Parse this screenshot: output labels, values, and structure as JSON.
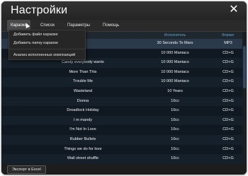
{
  "window": {
    "title": "Настройки",
    "close_glyph": "✕"
  },
  "tabs": [
    {
      "label": "Караоке"
    },
    {
      "label": "Список"
    },
    {
      "label": "Параметры"
    },
    {
      "label": "Помощь"
    }
  ],
  "grid": {
    "headers": {
      "title": "",
      "artist": "Исполнитель",
      "format": "Формат"
    },
    "rows": [
      {
        "title": "",
        "artist": "30 Seconds To Mars",
        "format": "MP3"
      },
      {
        "title": "",
        "artist": "10 000 Maniacs",
        "format": "CD+G"
      },
      {
        "title": "Candy everybody wants",
        "artist": "10 000 Maniacs",
        "format": "CD+G"
      },
      {
        "title": "More Than This",
        "artist": "10 000 Maniacs",
        "format": "CD+G"
      },
      {
        "title": "Trouble Me",
        "artist": "10 000 Maniacs",
        "format": "CD+G"
      },
      {
        "title": "Wasteland",
        "artist": "10 Years",
        "format": "CD+G"
      },
      {
        "title": "Donna",
        "artist": "10cc",
        "format": "CD+G"
      },
      {
        "title": "Dreadlock Holiday",
        "artist": "10cc",
        "format": "CD+G"
      },
      {
        "title": "I m mandy",
        "artist": "10cc",
        "format": "CD+G"
      },
      {
        "title": "I'm Not In Love",
        "artist": "10cc",
        "format": "CD+G"
      },
      {
        "title": "Rubber Bullets",
        "artist": "10cc",
        "format": "CD+G"
      },
      {
        "title": "Things we do for love",
        "artist": "10cc",
        "format": "CD+G"
      },
      {
        "title": "Wall street shuffle",
        "artist": "10cc",
        "format": "CD+G"
      }
    ]
  },
  "menu": {
    "items": [
      {
        "label": "Добавить файл караоке"
      },
      {
        "label": "Добавить папку караоке"
      },
      {
        "label": "Анализ исполненных композиций"
      }
    ]
  },
  "footer": {
    "export_label": "Экспорт в Excel"
  }
}
